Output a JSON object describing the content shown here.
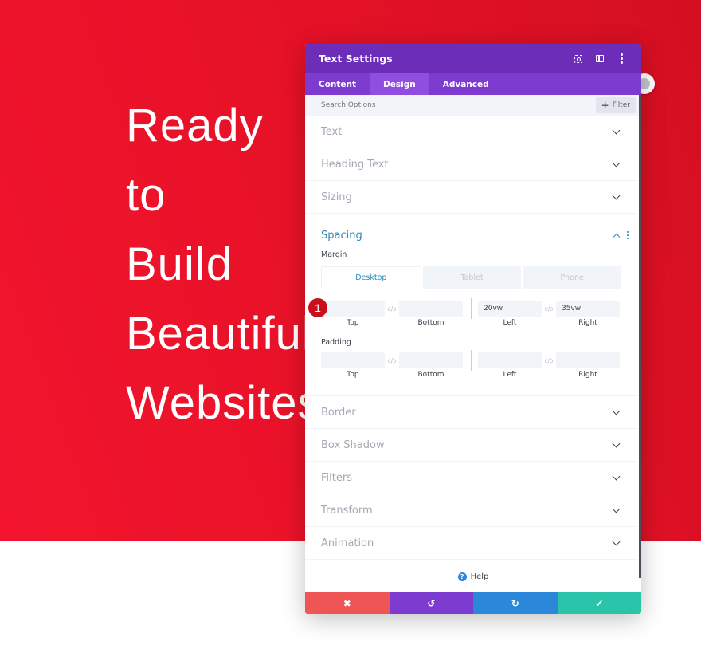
{
  "hero": {
    "lines": [
      "Ready",
      "to",
      "Build",
      "Beautiful",
      "Websites"
    ]
  },
  "panel": {
    "title": "Text Settings",
    "header_icons": [
      "focus-icon",
      "split-view-icon",
      "more-options-icon"
    ],
    "tabs": [
      {
        "label": "Content",
        "active": false
      },
      {
        "label": "Design",
        "active": true
      },
      {
        "label": "Advanced",
        "active": false
      }
    ],
    "search": {
      "placeholder": "Search Options",
      "value": ""
    },
    "filter_label": "Filter",
    "sections_before": [
      {
        "label": "Text"
      },
      {
        "label": "Heading Text"
      },
      {
        "label": "Sizing"
      }
    ],
    "spacing": {
      "title": "Spacing",
      "margin_label": "Margin",
      "devices": [
        "Desktop",
        "Tablet",
        "Phone"
      ],
      "active_device": "Desktop",
      "margin": {
        "top": "",
        "bottom": "",
        "left": "20vw",
        "right": "35vw"
      },
      "padding_label": "Padding",
      "padding": {
        "top": "",
        "bottom": "",
        "left": "",
        "right": ""
      },
      "field_labels": {
        "top": "Top",
        "bottom": "Bottom",
        "left": "Left",
        "right": "Right"
      },
      "link_glyph": "c/ɔ"
    },
    "sections_after": [
      {
        "label": "Border"
      },
      {
        "label": "Box Shadow"
      },
      {
        "label": "Filters"
      },
      {
        "label": "Transform"
      },
      {
        "label": "Animation"
      }
    ],
    "help_label": "Help",
    "footer": {
      "cancel": "✖",
      "undo": "↺",
      "redo": "↻",
      "save": "✔"
    }
  },
  "annotation_badge": "1",
  "colors": {
    "hero_red": "#e81228",
    "header_purple": "#6c2eb9",
    "tab_purple": "#7e3bd0",
    "accent_blue": "#2b87b8",
    "cancel_red": "#ef5555",
    "redo_blue": "#2b87da",
    "save_green": "#29c4a9"
  }
}
